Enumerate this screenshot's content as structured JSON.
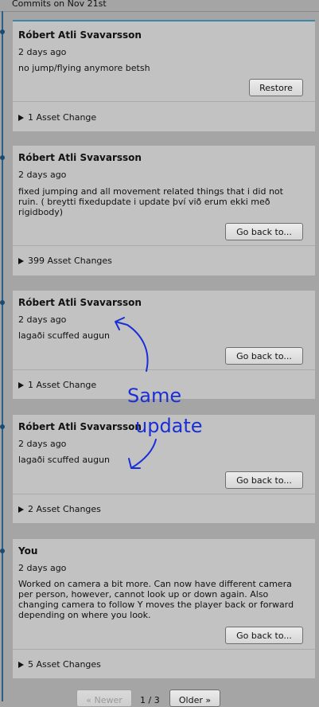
{
  "header": {
    "title": "Commits on Nov 21st"
  },
  "commits": [
    {
      "author": "Róbert Atli Svavarsson",
      "time": "2 days ago",
      "message": "no jump/flying anymore betsh",
      "button": "Restore",
      "assets": "1 Asset Change"
    },
    {
      "author": "Róbert Atli Svavarsson",
      "time": "2 days ago",
      "message": "fixed jumping and all movement related things that i did not ruin. ( breytti fixedupdate i update því við erum ekki með rigidbody)",
      "button": "Go back to...",
      "assets": "399 Asset Changes"
    },
    {
      "author": "Róbert Atli Svavarsson",
      "time": "2 days ago",
      "message": "lagaði scuffed augun",
      "button": "Go back to...",
      "assets": "1 Asset Change"
    },
    {
      "author": "Róbert Atli Svavarsson",
      "time": "2 days ago",
      "message": "lagaði scuffed augun",
      "button": "Go back to...",
      "assets": "2 Asset Changes"
    },
    {
      "author": "You",
      "time": "2 days ago",
      "message": "Worked on camera a bit more. Can now have different camera per person, however, cannot look up or down again. Also changing camera to follow Y moves the player back or forward depending on where you look.",
      "button": "Go back to...",
      "assets": "5 Asset Changes"
    }
  ],
  "pagination": {
    "newer": "« Newer",
    "page": "1 / 3",
    "older": "Older »"
  },
  "annotation": {
    "line1": "Same",
    "line2": "update",
    "color": "#1a2fd6"
  },
  "colors": {
    "timeline": "#2a5f88",
    "selected_border": "#3d87a8",
    "card_bg": "#c2c2c2"
  }
}
